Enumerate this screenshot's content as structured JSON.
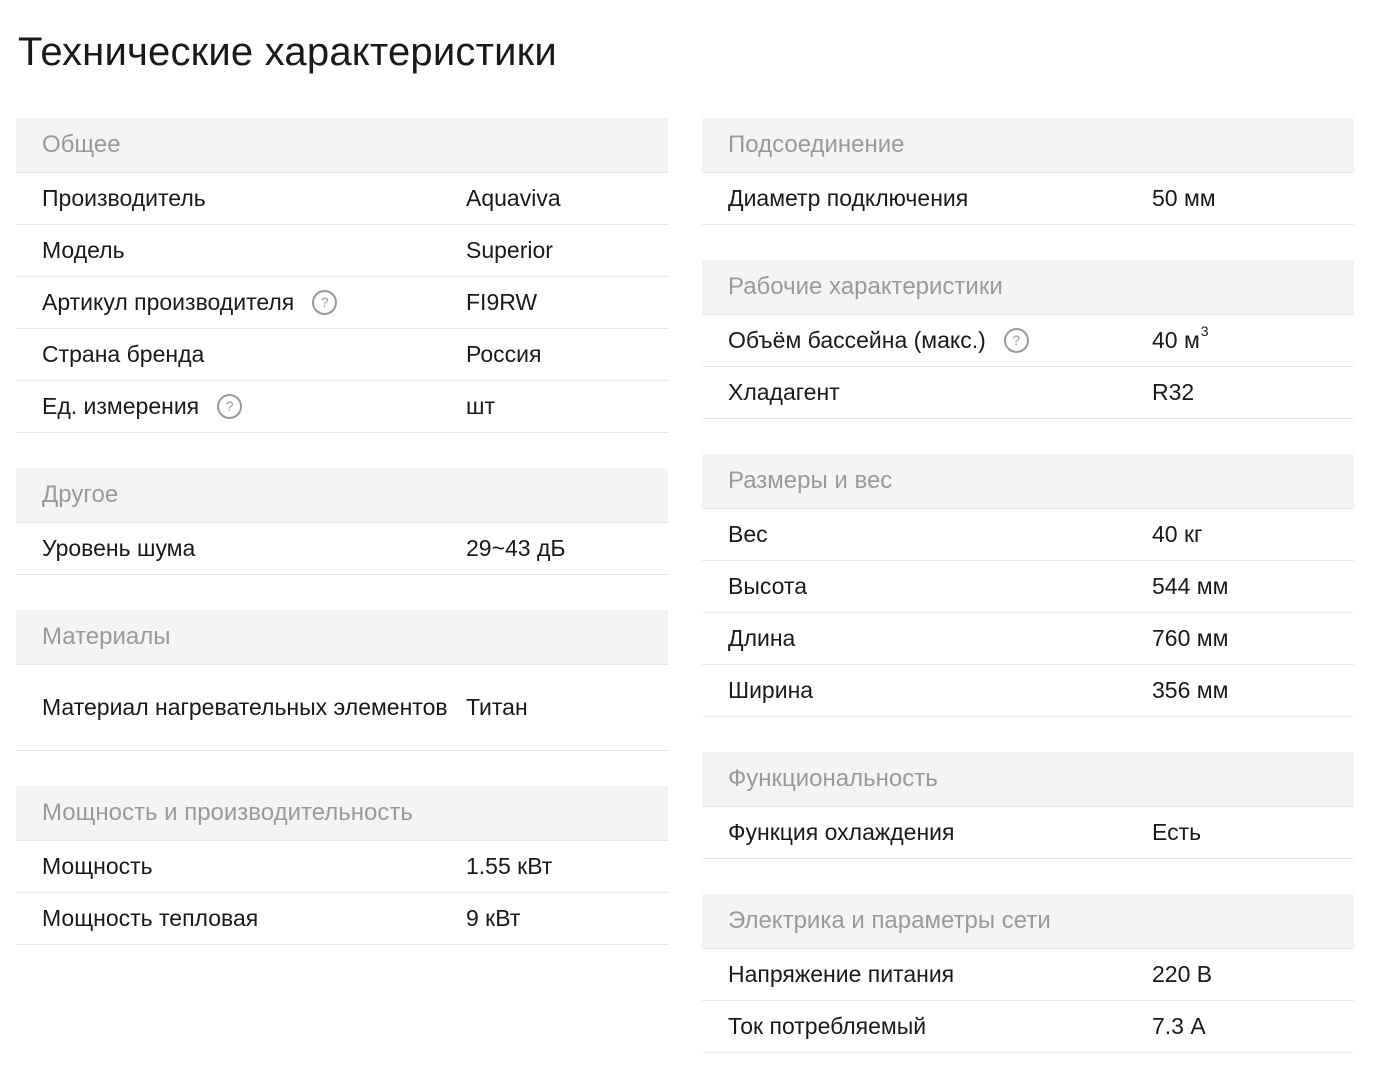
{
  "title": "Технические характеристики",
  "columns": [
    [
      {
        "title": "Общее",
        "rows": [
          {
            "label": "Производитель",
            "value": "Aquaviva"
          },
          {
            "label": "Модель",
            "value": "Superior"
          },
          {
            "label": "Артикул производителя",
            "value": "FI9RW",
            "help": true
          },
          {
            "label": "Страна бренда",
            "value": "Россия"
          },
          {
            "label": "Ед. измерения",
            "value": "шт",
            "help": true
          }
        ]
      },
      {
        "title": "Другое",
        "rows": [
          {
            "label": "Уровень шума",
            "value": "29~43 дБ"
          }
        ]
      },
      {
        "title": "Материалы",
        "rows": [
          {
            "label": "Материал нагревательных элементов",
            "value": "Титан",
            "tall": true
          }
        ]
      },
      {
        "title": "Мощность и производительность",
        "rows": [
          {
            "label": "Мощность",
            "value": "1.55 кВт"
          },
          {
            "label": "Мощность тепловая",
            "value": "9 кВт"
          }
        ]
      }
    ],
    [
      {
        "title": "Подсоединение",
        "rows": [
          {
            "label": "Диаметр подключения",
            "value": "50 мм"
          }
        ]
      },
      {
        "title": "Рабочие характеристики",
        "rows": [
          {
            "label": "Объём бассейна (макс.)",
            "value": "40 м",
            "sup": "3",
            "help": true
          },
          {
            "label": "Хладагент",
            "value": "R32"
          }
        ]
      },
      {
        "title": "Размеры и вес",
        "rows": [
          {
            "label": "Вес",
            "value": "40 кг"
          },
          {
            "label": "Высота",
            "value": "544 мм"
          },
          {
            "label": "Длина",
            "value": "760 мм"
          },
          {
            "label": "Ширина",
            "value": "356 мм"
          }
        ]
      },
      {
        "title": "Функциональность",
        "rows": [
          {
            "label": "Функция охлаждения",
            "value": "Есть"
          }
        ]
      },
      {
        "title": "Электрика и параметры сети",
        "rows": [
          {
            "label": "Напряжение питания",
            "value": "220 В"
          },
          {
            "label": "Ток потребляемый",
            "value": "7.3 А"
          }
        ]
      }
    ]
  ],
  "help_glyph": "?"
}
